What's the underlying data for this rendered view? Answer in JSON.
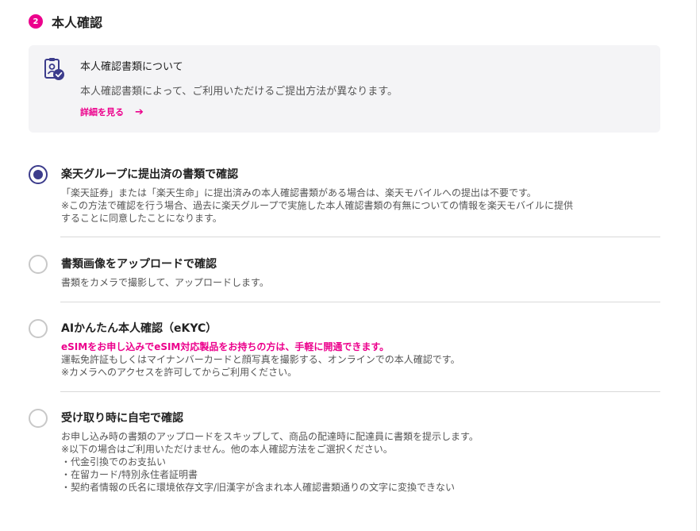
{
  "section": {
    "step_number": "2",
    "title": "本人確認"
  },
  "info": {
    "icon": "id-document-check-icon",
    "title": "本人確認書類について",
    "description": "本人確認書類によって、ご利用いただけるご提出方法が異なります。",
    "link_label": "詳細を見る",
    "link_arrow": "➔"
  },
  "options": [
    {
      "selected": true,
      "title": "楽天グループに提出済の書類で確認",
      "lines": [
        "「楽天証券」または「楽天生命」に提出済みの本人確認書類がある場合は、楽天モバイルへの提出は不要です。",
        "※この方法で確認を行う場合、過去に楽天グループで実施した本人確認書類の有無についての情報を楽天モバイルに提供",
        "することに同意したことになります。"
      ]
    },
    {
      "selected": false,
      "title": "書類画像をアップロードで確認",
      "lines": [
        "書類をカメラで撮影して、アップロードします。"
      ]
    },
    {
      "selected": false,
      "title": "AIかんたん本人確認（eKYC）",
      "highlight": "eSIMをお申し込みでeSIM対応製品をお持ちの方は、手軽に開通できます。",
      "lines": [
        "運転免許証もしくはマイナンバーカードと顔写真を撮影する、オンラインでの本人確認です。",
        "※カメラへのアクセスを許可してからご利用ください。"
      ]
    },
    {
      "selected": false,
      "title": "受け取り時に自宅で確認",
      "lines": [
        "お申し込み時の書類のアップロードをスキップして、商品の配達時に配達員に書類を提示します。",
        "※以下の場合はご利用いただけません。他の本人確認方法をご選択ください。",
        "・代金引換でのお支払い",
        "・在留カード/特別永住者証明書",
        "・契約者情報の氏名に環境依存文字/旧漢字が含まれ本人確認書類通りの文字に変換できない"
      ]
    }
  ],
  "colors": {
    "accent": "#ec008c",
    "radio_selected": "#3c3c8c",
    "info_bg": "#f4f4f6"
  }
}
